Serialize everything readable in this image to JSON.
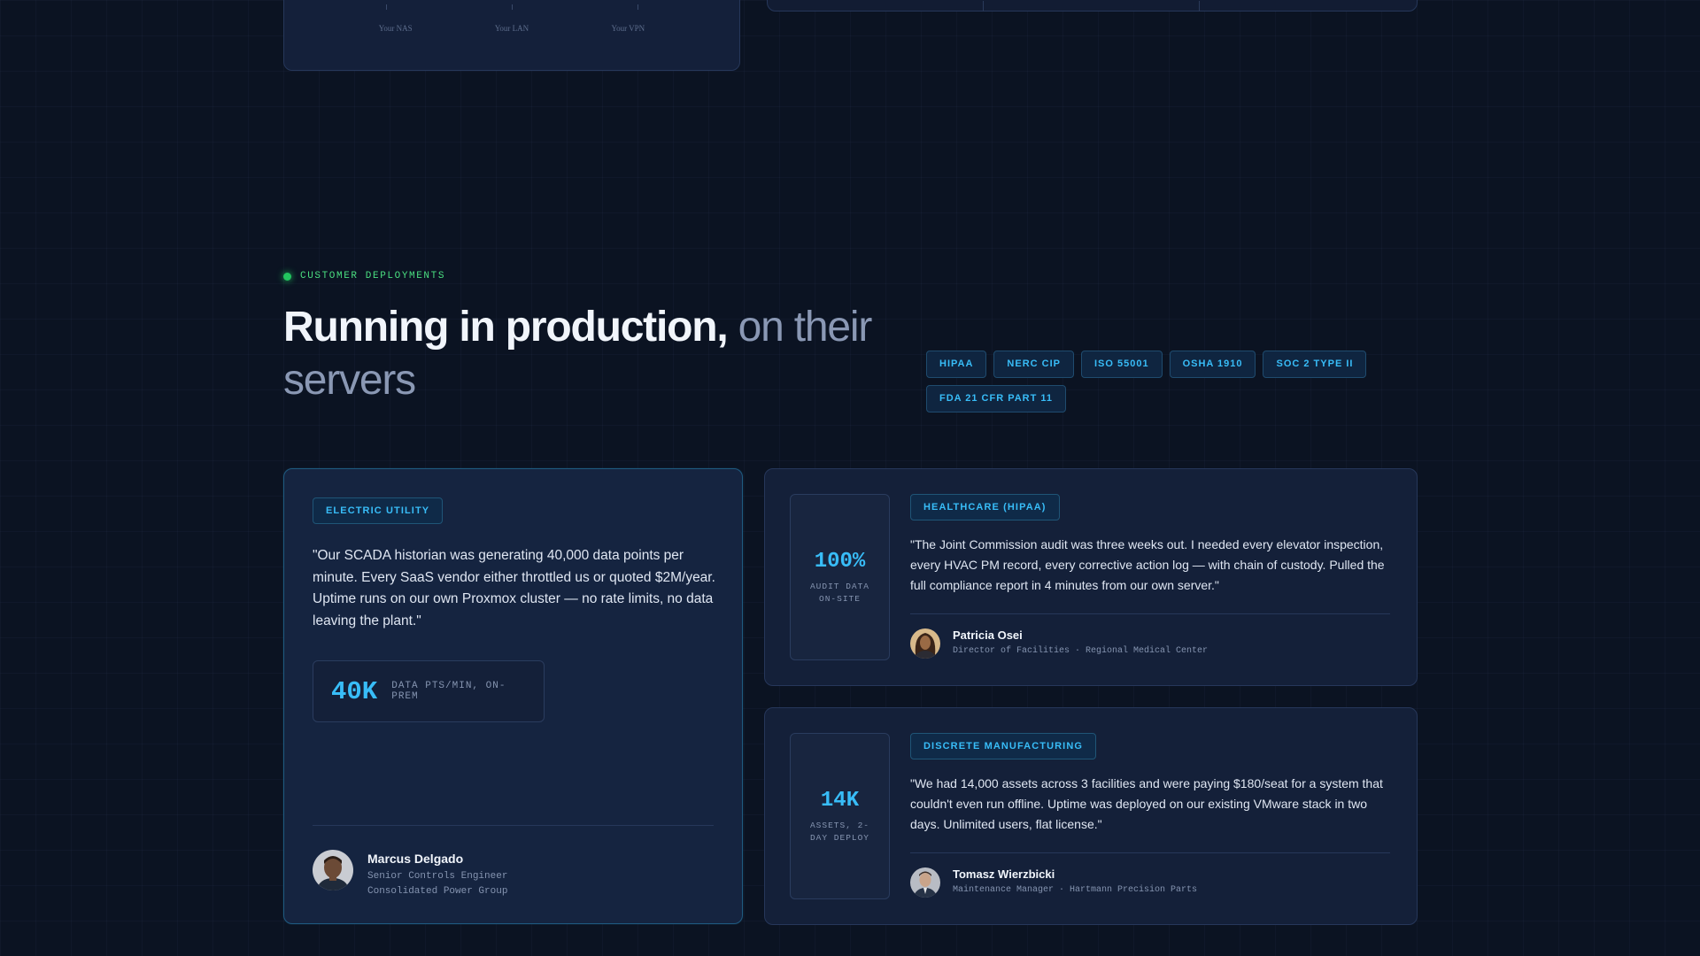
{
  "top_panel": {
    "axis_labels": [
      "Your NAS",
      "Your LAN",
      "Your VPN"
    ]
  },
  "section": {
    "eyebrow": "CUSTOMER DEPLOYMENTS",
    "headline_strong": "Running in production,",
    "headline_soft": " on their servers",
    "badges": [
      "HIPAA",
      "NERC CIP",
      "ISO 55001",
      "OSHA 1910",
      "SOC 2 TYPE II",
      "FDA 21 CFR PART 11"
    ]
  },
  "featured": {
    "tag": "ELECTRIC UTILITY",
    "quote": "\"Our SCADA historian was generating 40,000 data points per minute. Every SaaS vendor either throttled us or quoted $2M/year. Uptime runs on our own Proxmox cluster — no rate limits, no data leaving the plant.\"",
    "stat_value": "40K",
    "stat_label": "DATA PTS/MIN, ON-PREM",
    "person_name": "Marcus Delgado",
    "person_title": "Senior Controls Engineer",
    "person_company": "Consolidated Power Group"
  },
  "healthcare": {
    "metric_value": "100%",
    "metric_label": "AUDIT DATA ON-SITE",
    "tag": "HEALTHCARE (HIPAA)",
    "quote": "\"The Joint Commission audit was three weeks out. I needed every elevator inspection, every HVAC PM record, every corrective action log — with chain of custody. Pulled the full compliance report in 4 minutes from our own server.\"",
    "person_name": "Patricia Osei",
    "person_role": "Director of Facilities · Regional Medical Center"
  },
  "manufacturing": {
    "metric_value": "14K",
    "metric_label": "ASSETS, 2-DAY DEPLOY",
    "tag": "DISCRETE MANUFACTURING",
    "quote": "\"We had 14,000 assets across 3 facilities and were paying $180/seat for a system that couldn't even run offline. Uptime was deployed on our existing VMware stack in two days. Unlimited users, flat license.\"",
    "person_name": "Tomasz Wierzbicki",
    "person_role": "Maintenance Manager · Hartmann Precision Parts"
  },
  "colors": {
    "accent": "#38bdf8",
    "live_dot": "#22c55e",
    "background": "#0b1322"
  }
}
